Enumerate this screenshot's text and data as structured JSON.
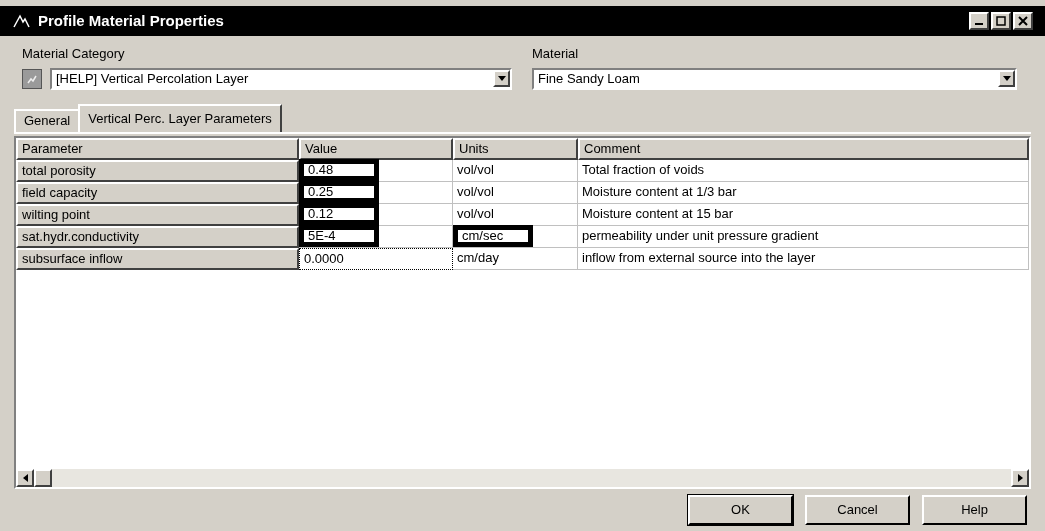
{
  "window": {
    "title": "Profile Material Properties"
  },
  "material_category": {
    "label": "Material Category",
    "value": "[HELP] Vertical Percolation Layer"
  },
  "material": {
    "label": "Material",
    "value": "Fine Sandy Loam"
  },
  "tabs": [
    {
      "label": "General",
      "selected": false
    },
    {
      "label": "Vertical Perc. Layer Parameters",
      "selected": true
    }
  ],
  "table": {
    "columns": [
      "Parameter",
      "Value",
      "Units",
      "Comment"
    ],
    "rows": [
      {
        "parameter": "total porosity",
        "value": "0.48",
        "value_highlighted": true,
        "units": "vol/vol",
        "units_highlighted": false,
        "comment": "Total fraction of voids"
      },
      {
        "parameter": "field capacity",
        "value": "0.25",
        "value_highlighted": true,
        "units": "vol/vol",
        "units_highlighted": false,
        "comment": "Moisture content at 1/3 bar"
      },
      {
        "parameter": "wilting point",
        "value": "0.12",
        "value_highlighted": true,
        "units": "vol/vol",
        "units_highlighted": false,
        "comment": "Moisture content at 15 bar"
      },
      {
        "parameter": "sat.hydr.conductivity",
        "value": "5E-4",
        "value_highlighted": true,
        "units": "cm/sec",
        "units_highlighted": true,
        "comment": "permeability under unit pressure gradient"
      },
      {
        "parameter": "subsurface inflow",
        "value": "0.0000",
        "value_highlighted": false,
        "units": "cm/day",
        "units_highlighted": false,
        "comment": "inflow from external source into the layer"
      }
    ]
  },
  "buttons": [
    "OK",
    "Cancel",
    "Help"
  ]
}
